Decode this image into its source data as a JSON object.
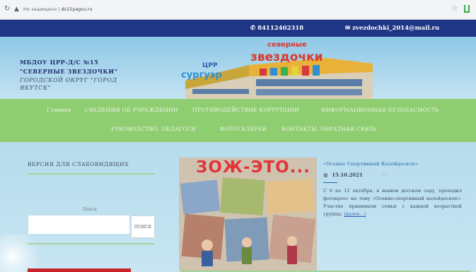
{
  "browser": {
    "reload_icon": "reload-icon",
    "security_label": "Не защищено",
    "url": "ds15yagsu.ru",
    "bookmark_icon": "star-icon"
  },
  "contacts": {
    "phone": "84112402318",
    "email": "zvezdochki_2014@mail.ru"
  },
  "header": {
    "line1": "МБДОУ ЦРР-Д/С №15",
    "line2": "\"СЕВЕРНЫЕ ЗВЕЗДОЧКИ\"",
    "line3": "ГОРОДСКОЙ ОКРУГ \"ГОРОД",
    "line4": "ЯКУТСК\"",
    "logo_word1": "северные",
    "logo_word2": "звездочки",
    "logo_small": "ЦРР",
    "logo_left": "сургуэр"
  },
  "nav": {
    "items": [
      "Главная",
      "СВЕДЕНИЯ ОБ УЧРЕЖДЕНИИ",
      "ПРОТИВОДЕЙСТВИЕ КОРРУПЦИИ",
      "ИНФОРМАЦИОННАЯ БЕЗОПАСНОСТЬ",
      "РУКОВОДСТВО. ПЕДАГОГИ",
      "ФОТОГАЛЕРЕЯ",
      "КОНТАКТЫ. ОБРАТНАЯ СВЯЗЬ"
    ]
  },
  "sidebar": {
    "low_vision_label": "ВЕРСИЯ ДЛЯ СЛАБОВИДЯЩИХ",
    "search_label": "Поиск",
    "search_value": "",
    "search_button": "ПОИСК"
  },
  "post": {
    "photo_banner": "ЗОЖ-ЭТО...",
    "title": "«Осенне Спортивный Калейдоскоп»",
    "date": "15.10.2021",
    "text": "С 6 по 12 октября, в нашем детском саду, проходил фотокросс на тему «Осенне-спортивный калейдоскоп». Участие принимали семьи с каждой возрастной группы.",
    "more": "(далее...)"
  }
}
